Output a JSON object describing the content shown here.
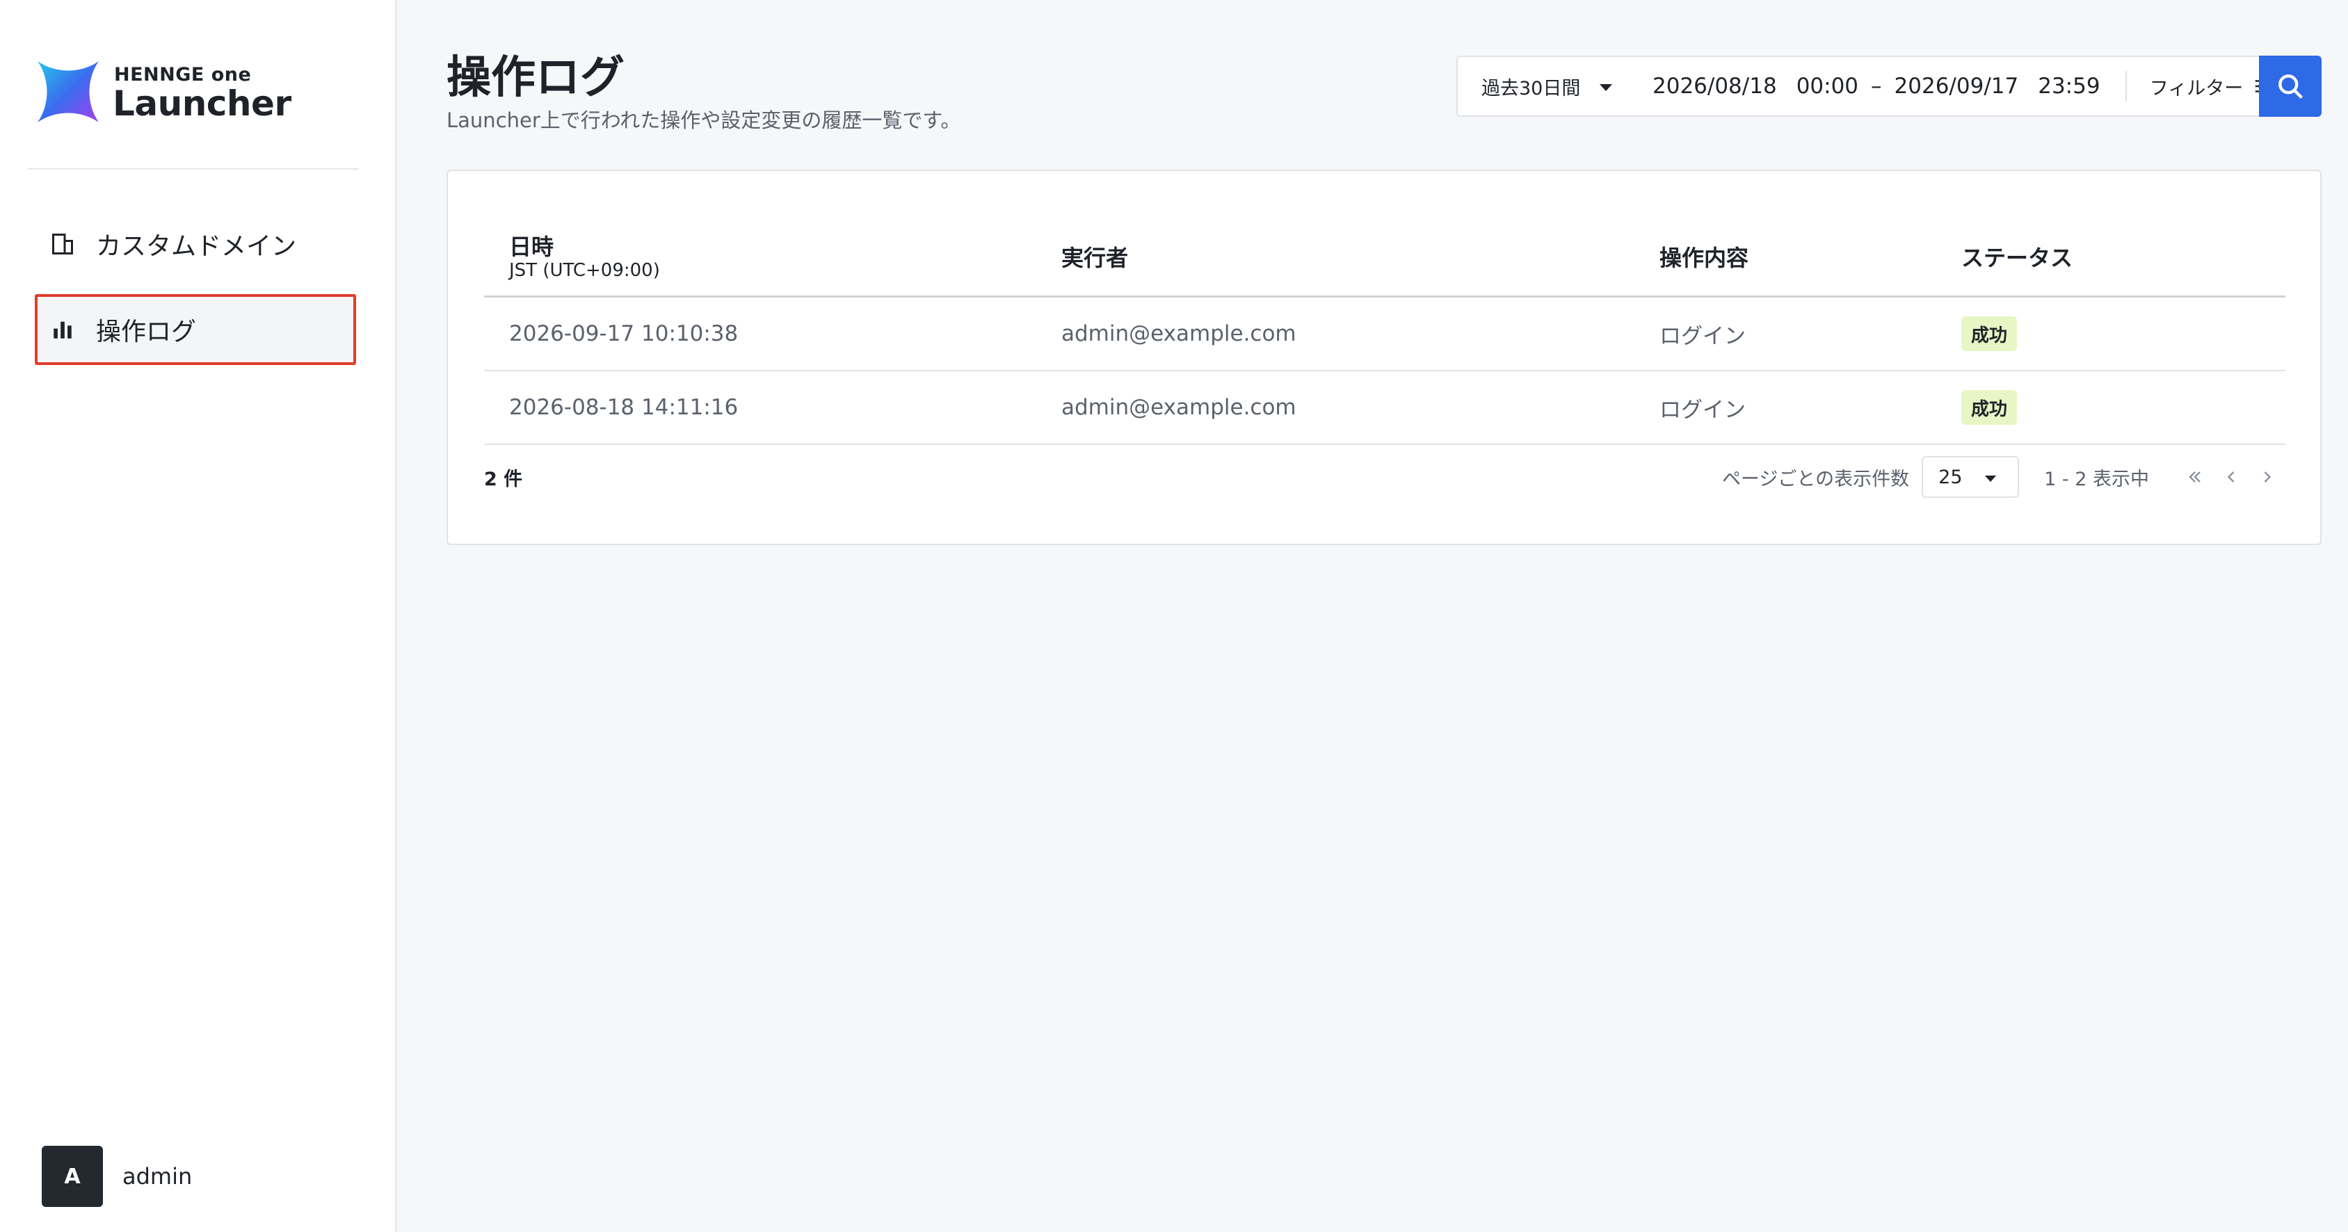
{
  "brand": {
    "small_text": "HENNGE one",
    "big_text": "Launcher"
  },
  "sidebar": {
    "items": [
      {
        "label": "カスタムドメイン",
        "icon": "building-icon"
      },
      {
        "label": "操作ログ",
        "icon": "bar-chart-icon",
        "active": true
      }
    ],
    "user": {
      "initial": "A",
      "name": "admin"
    }
  },
  "header": {
    "title": "操作ログ",
    "subtitle": "Launcher上で行われた操作や設定変更の履歴一覧です。"
  },
  "toolbar": {
    "range_label": "過去30日間",
    "start_date": "2026/08/18",
    "start_time": "00:00",
    "separator": "–",
    "end_date": "2026/09/17",
    "end_time": "23:59",
    "filter_label": "フィルター",
    "search_icon": "search-icon"
  },
  "table": {
    "columns": [
      {
        "label": "日時",
        "sub": "JST (UTC+09:00)"
      },
      {
        "label": "実行者"
      },
      {
        "label": "操作内容"
      },
      {
        "label": "ステータス"
      }
    ],
    "rows": [
      {
        "datetime": "2026-09-17 10:10:38",
        "actor": "admin@example.com",
        "action": "ログイン",
        "status": "成功"
      },
      {
        "datetime": "2026-08-18 14:11:16",
        "actor": "admin@example.com",
        "action": "ログイン",
        "status": "成功"
      }
    ]
  },
  "footer": {
    "total": "2 件",
    "per_page_label": "ページごとの表示件数",
    "per_page_value": "25",
    "range_info": "1 - 2 表示中"
  },
  "colors": {
    "accent": "#2e6ae6",
    "highlight_border": "#e23c2b",
    "success_badge": "#e8f5c5"
  }
}
